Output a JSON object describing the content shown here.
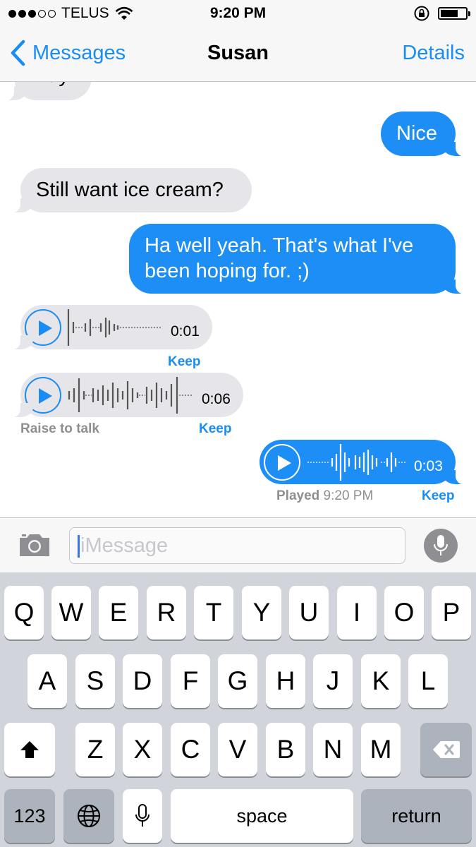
{
  "status": {
    "carrier": "TELUS",
    "time": "9:20 PM"
  },
  "nav": {
    "back_label": "Messages",
    "title": "Susan",
    "details_label": "Details"
  },
  "messages": [
    {
      "type": "text",
      "from": "contact",
      "text": "Yay!"
    },
    {
      "type": "text",
      "from": "me",
      "text": "Nice"
    },
    {
      "type": "text",
      "from": "contact",
      "text": "Still want ice cream?"
    },
    {
      "type": "text",
      "from": "me",
      "lines": [
        "Ha well yeah. That's what I've",
        "been hoping for. ;)"
      ]
    },
    {
      "type": "audio",
      "from": "contact",
      "duration": "0:01",
      "action": "Keep"
    },
    {
      "type": "audio",
      "from": "contact",
      "duration": "0:06",
      "action": "Keep",
      "hint": "Raise to talk"
    },
    {
      "type": "audio",
      "from": "me",
      "duration": "0:03",
      "action": "Keep",
      "status_label": "Played",
      "status_time": "9:20 PM"
    }
  ],
  "input": {
    "placeholder": "iMessage"
  },
  "keyboard": {
    "row1": [
      "Q",
      "W",
      "E",
      "R",
      "T",
      "Y",
      "U",
      "I",
      "O",
      "P"
    ],
    "row2": [
      "A",
      "S",
      "D",
      "F",
      "G",
      "H",
      "J",
      "K",
      "L"
    ],
    "row3": [
      "Z",
      "X",
      "C",
      "V",
      "B",
      "N",
      "M"
    ],
    "numbers_label": "123",
    "space_label": "space",
    "return_label": "return"
  },
  "icons": [
    "chevron-left-icon",
    "wifi-icon",
    "rotation-lock-icon",
    "battery-icon",
    "play-icon",
    "camera-icon",
    "microphone-icon",
    "shift-icon",
    "delete-icon",
    "globe-icon",
    "dictation-mic-icon"
  ],
  "colors": {
    "accent": "#1a8cf5",
    "outgoing_bubble": "#1d8ef5",
    "incoming_bubble": "#e5e5ea",
    "keyboard_bg": "#d1d5db"
  }
}
